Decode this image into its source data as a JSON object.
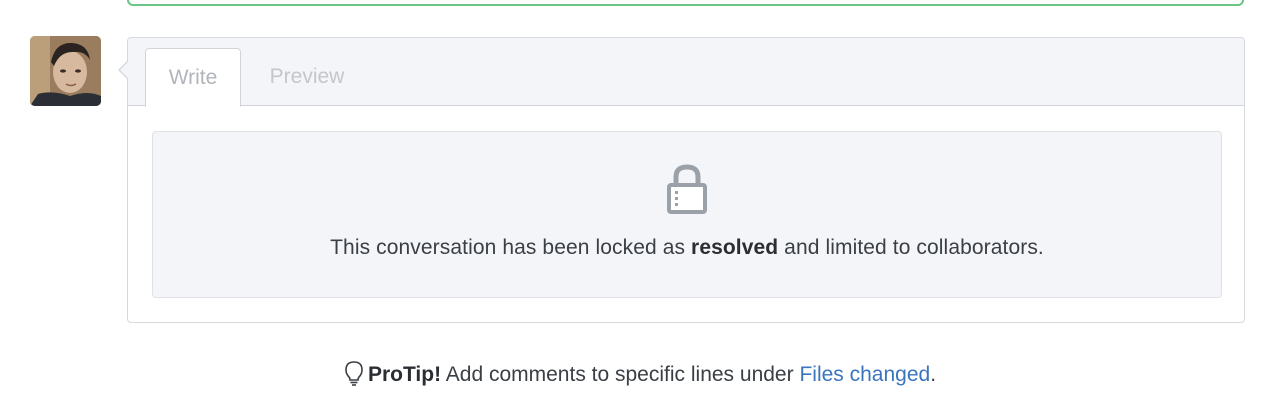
{
  "tabs": {
    "write": "Write",
    "preview": "Preview"
  },
  "locked": {
    "text_before": "This conversation has been locked as",
    "reason": "resolved",
    "text_after": "and limited to collaborators."
  },
  "protip": {
    "label": "ProTip!",
    "text": "Add comments to specific lines under",
    "link": "Files changed",
    "suffix": "."
  },
  "icons": {
    "lock": "lock-icon",
    "bulb": "light-bulb-icon"
  },
  "colors": {
    "border_green": "#6cc486",
    "link": "#3a76bd",
    "panel_bg": "#f4f5f8"
  }
}
